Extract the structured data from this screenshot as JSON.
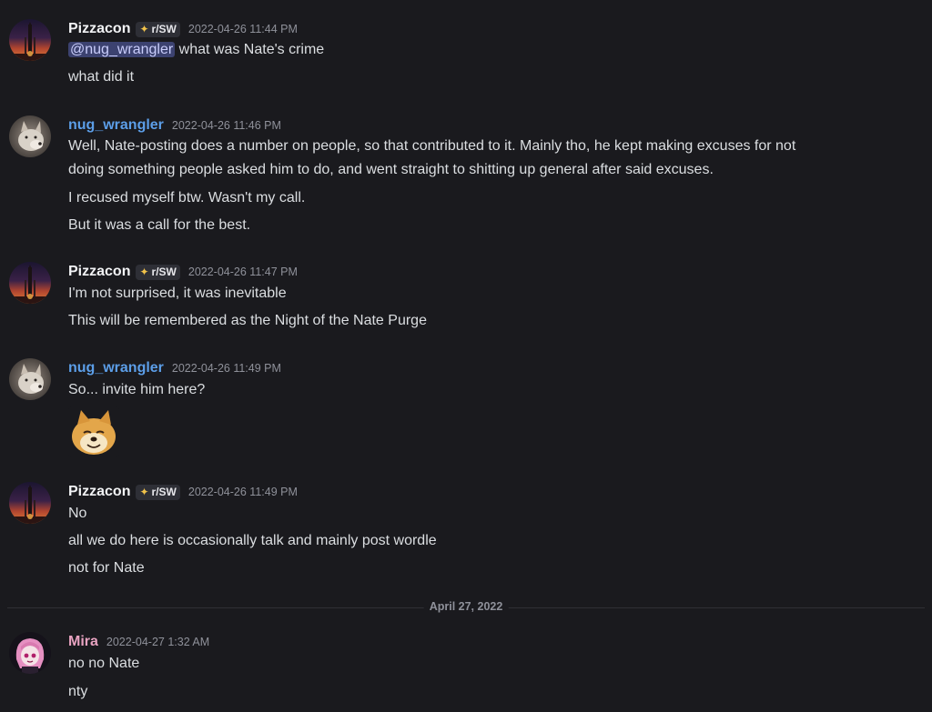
{
  "messages": [
    {
      "username": "Pizzacon",
      "tag": "r/SW",
      "timestamp": "2022-04-26 11:44 PM",
      "mention": "@nug_wrangler",
      "lines": [
        "what was Nate's crime",
        "what did it"
      ]
    },
    {
      "username": "nug_wrangler",
      "timestamp": "2022-04-26 11:46 PM",
      "lines": [
        "Well, Nate-posting does a number on people, so that contributed to it. Mainly tho, he kept making excuses for not",
        "doing something people asked him to do, and went straight to shitting up general after said excuses.",
        "I recused myself btw. Wasn't my call.",
        "But it was a call for the best."
      ]
    },
    {
      "username": "Pizzacon",
      "tag": "r/SW",
      "timestamp": "2022-04-26 11:47 PM",
      "lines": [
        "I'm not surprised, it was inevitable",
        "This will be remembered as the Night of the Nate Purge"
      ]
    },
    {
      "username": "nug_wrangler",
      "timestamp": "2022-04-26 11:49 PM",
      "lines": [
        "So... invite him here?"
      ]
    },
    {
      "username": "Pizzacon",
      "tag": "r/SW",
      "timestamp": "2022-04-26 11:49 PM",
      "lines": [
        "No",
        "all we do here is occasionally talk and mainly post wordle",
        "not for Nate"
      ]
    },
    {
      "username": "Mira",
      "timestamp": "2022-04-27 1:32 AM",
      "lines": [
        "no no Nate",
        "nty"
      ]
    }
  ],
  "date_divider": "April 27, 2022",
  "icons": {
    "tag_icon": "sparkle-icon",
    "emoji": "cheems-doge-emoji"
  },
  "colors": {
    "background": "#1a1a1e",
    "pizzacon": "#f2f3f5",
    "nug_wrangler": "#5c9ee8",
    "mira": "#e8a3c1",
    "mention_bg": "#3c4270"
  }
}
